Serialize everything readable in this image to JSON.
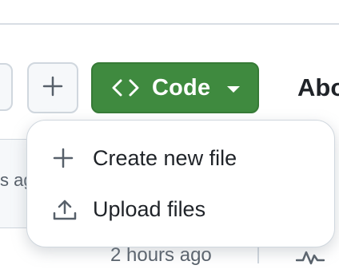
{
  "toolbar": {
    "code_button_label": "Code"
  },
  "sidebar": {
    "heading_fragment": "Abo"
  },
  "file_list": {
    "row_fragment": "s ag",
    "timestamp": "2 hours ago"
  },
  "add_file_menu": {
    "items": [
      {
        "label": "Create new file",
        "icon": "plus-icon"
      },
      {
        "label": "Upload files",
        "icon": "upload-icon"
      }
    ]
  },
  "colors": {
    "code_button_bg": "#3f8a3f",
    "border": "#d0d7de",
    "text": "#1f2328",
    "muted_text": "#57606a"
  }
}
